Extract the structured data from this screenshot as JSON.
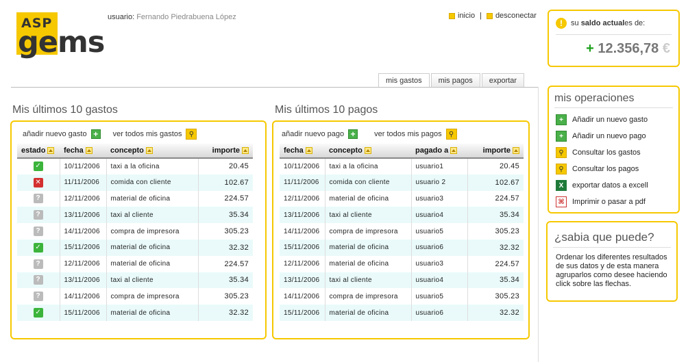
{
  "logo": {
    "top": "ASP",
    "bottom": "gems"
  },
  "user": {
    "label": "usuario:",
    "name": "Fernando Piedrabuena López"
  },
  "toplinks": {
    "inicio": "inicio",
    "sep": "|",
    "desconectar": "desconectar"
  },
  "balance": {
    "prefix": "su ",
    "bold": "saldo actual",
    "suffix": " es de:",
    "sign": "+",
    "amount": "12.356,78",
    "currency": "€"
  },
  "tabs": [
    "mis gastos",
    "mis pagos",
    "exportar"
  ],
  "gastos": {
    "title": "Mis últimos 10 gastos",
    "add": "añadir nuevo gasto",
    "view": "ver todos mis gastos",
    "headers": [
      "estado",
      "fecha",
      "concepto",
      "importe"
    ],
    "rows": [
      {
        "estado": "ok",
        "fecha": "10/11/2006",
        "concepto": "taxi a la oficina",
        "importe": "20.45"
      },
      {
        "estado": "bad",
        "fecha": "11/11/2006",
        "concepto": "comida con cliente",
        "importe": "102.67"
      },
      {
        "estado": "q",
        "fecha": "12/11/2006",
        "concepto": "material de oficina",
        "importe": "224.57"
      },
      {
        "estado": "q",
        "fecha": "13/11/2006",
        "concepto": "taxi al cliente",
        "importe": "35.34"
      },
      {
        "estado": "q",
        "fecha": "14/11/2006",
        "concepto": "compra de impresora",
        "importe": "305.23"
      },
      {
        "estado": "ok",
        "fecha": "15/11/2006",
        "concepto": "material de oficina",
        "importe": "32.32"
      },
      {
        "estado": "q",
        "fecha": "12/11/2006",
        "concepto": "material de oficina",
        "importe": "224.57"
      },
      {
        "estado": "q",
        "fecha": "13/11/2006",
        "concepto": "taxi al cliente",
        "importe": "35.34"
      },
      {
        "estado": "q",
        "fecha": "14/11/2006",
        "concepto": "compra de impresora",
        "importe": "305.23"
      },
      {
        "estado": "ok",
        "fecha": "15/11/2006",
        "concepto": "material de oficina",
        "importe": "32.32"
      }
    ]
  },
  "pagos": {
    "title": "Mis últimos 10 pagos",
    "add": "añadir nuevo pago",
    "view": "ver todos mis pagos",
    "headers": [
      "fecha",
      "concepto",
      "pagado a",
      "importe"
    ],
    "rows": [
      {
        "fecha": "10/11/2006",
        "concepto": "taxi a la oficina",
        "pagado": "usuario1",
        "importe": "20.45"
      },
      {
        "fecha": "11/11/2006",
        "concepto": "comida con cliente",
        "pagado": "usuario 2",
        "importe": "102.67"
      },
      {
        "fecha": "12/11/2006",
        "concepto": "material de oficina",
        "pagado": "usuario3",
        "importe": "224.57"
      },
      {
        "fecha": "13/11/2006",
        "concepto": "taxi al cliente",
        "pagado": "usuario4",
        "importe": "35.34"
      },
      {
        "fecha": "14/11/2006",
        "concepto": "compra de impresora",
        "pagado": "usuario5",
        "importe": "305.23"
      },
      {
        "fecha": "15/11/2006",
        "concepto": "material de oficina",
        "pagado": "usuario6",
        "importe": "32.32"
      },
      {
        "fecha": "12/11/2006",
        "concepto": "material de oficina",
        "pagado": "usuario3",
        "importe": "224.57"
      },
      {
        "fecha": "13/11/2006",
        "concepto": "taxi al cliente",
        "pagado": "usuario4",
        "importe": "35.34"
      },
      {
        "fecha": "14/11/2006",
        "concepto": "compra de impresora",
        "pagado": "usuario5",
        "importe": "305.23"
      },
      {
        "fecha": "15/11/2006",
        "concepto": "material de oficina",
        "pagado": "usuario6",
        "importe": "32.32"
      }
    ]
  },
  "ops": {
    "title": "mis operaciones",
    "items": [
      {
        "label": "Añadir un nuevo gasto",
        "icon": "add-icon"
      },
      {
        "label": "Añadir un nuevo pago",
        "icon": "add-icon"
      },
      {
        "label": "Consultar los gastos",
        "icon": "search-icon"
      },
      {
        "label": "Consultar los pagos",
        "icon": "search-icon"
      },
      {
        "label": "exportar datos a excell",
        "icon": "excel-icon"
      },
      {
        "label": "Imprimir o pasar a pdf",
        "icon": "pdf-icon"
      }
    ]
  },
  "tip": {
    "title": "¿sabia que puede?",
    "text": "Ordenar los diferentes resultados de sus datos y de esta manera agruparlos como desee haciendo click sobre las flechas."
  },
  "colors": {
    "accent": "#f6c800",
    "ok": "#3cb43c",
    "error": "#d43030",
    "rowAlt": "#eafafa"
  }
}
